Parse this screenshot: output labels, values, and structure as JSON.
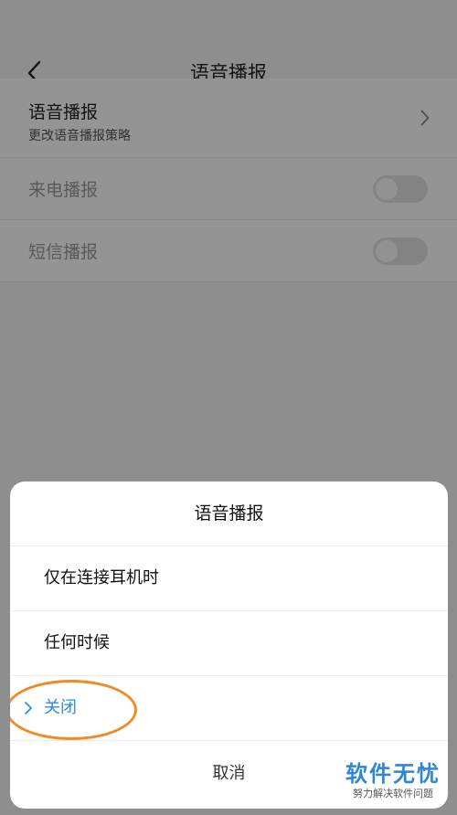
{
  "screen": {
    "header_title": "语音播报",
    "items": [
      {
        "title": "语音播报",
        "subtitle": "更改语音播报策略"
      },
      {
        "title": "来电播报",
        "switch_on": false
      },
      {
        "title": "短信播报",
        "switch_on": false
      }
    ]
  },
  "dialog": {
    "title": "语音播报",
    "options": [
      {
        "label": "仅在连接耳机时",
        "selected": false
      },
      {
        "label": "任何时候",
        "selected": false
      },
      {
        "label": "关闭",
        "selected": true
      }
    ],
    "cancel_label": "取消"
  },
  "watermark": {
    "main": "软件无忧",
    "sub": "努力解决软件问题"
  },
  "colors": {
    "accent": "#2d8de0",
    "highlight_ring": "#f08a24"
  }
}
